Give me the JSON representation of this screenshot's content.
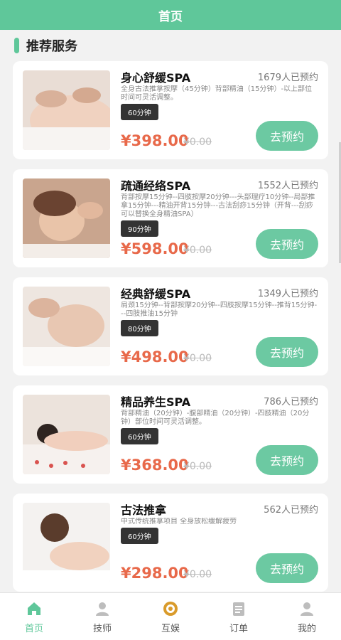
{
  "header": {
    "title": "首页"
  },
  "section": {
    "title": "推荐服务"
  },
  "services": [
    {
      "name": "身心舒缓SPA",
      "booked": "1679人已预约",
      "desc": "全身古法推拿按摩（45分钟）背部精油（15分钟）-以上部位时间可灵活调整。",
      "duration": "60分钟",
      "price": "¥398.00",
      "orig_price": "¥0.00",
      "book_label": "去预约"
    },
    {
      "name": "疏通经络SPA",
      "booked": "1552人已预约",
      "desc": "背部按摩15分钟--四肢按摩20分钟---头部理疗10分钟--局部推拿15分钟---精油开背15分钟---古法刮痧15分钟（开背---刮痧可以替换全身精油SPA）",
      "duration": "90分钟",
      "price": "¥598.00",
      "orig_price": "¥0.00",
      "book_label": "去预约"
    },
    {
      "name": "经典舒缓SPA",
      "booked": "1349人已预约",
      "desc": "肩颈15分钟--背部按摩20分钟--四肢按摩15分钟--推背15分钟---四肢推油15分钟",
      "duration": "80分钟",
      "price": "¥498.00",
      "orig_price": "¥0.00",
      "book_label": "去预约"
    },
    {
      "name": "精品养生SPA",
      "booked": "786人已预约",
      "desc": "背部精油（20分钟）-腹部精油（20分钟）-四肢精油（20分钟）部位时间可灵活调整。",
      "duration": "60分钟",
      "price": "¥368.00",
      "orig_price": "¥0.00",
      "book_label": "去预约"
    },
    {
      "name": "古法推拿",
      "booked": "562人已预约",
      "desc": "中式传统推拿项目 全身放松缓解疲劳",
      "duration": "60分钟",
      "price": "¥298.00",
      "orig_price": "¥0.00",
      "book_label": "去预约"
    }
  ],
  "tabbar": [
    {
      "label": "首页",
      "icon": "home-icon",
      "active": true
    },
    {
      "label": "技师",
      "icon": "technician-icon",
      "active": false
    },
    {
      "label": "互娱",
      "icon": "entertainment-icon",
      "active": false
    },
    {
      "label": "订单",
      "icon": "order-icon",
      "active": false
    },
    {
      "label": "我的",
      "icon": "profile-icon",
      "active": false
    }
  ],
  "colors": {
    "accent": "#5fc79a",
    "price": "#e8694a",
    "badge": "#333333"
  }
}
